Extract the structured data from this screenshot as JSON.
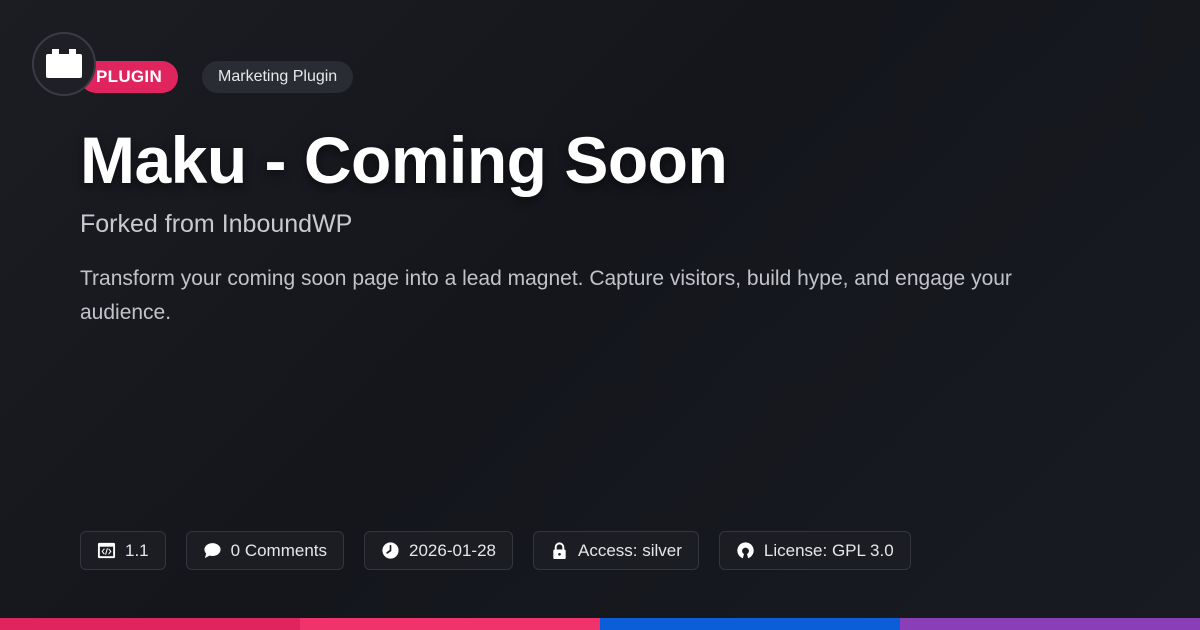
{
  "header": {
    "logo_icon": "plugin-block-icon",
    "type_tag": "PLUGIN",
    "category_tag": "Marketing Plugin"
  },
  "main": {
    "title": "Maku - Coming Soon",
    "subtitle": "Forked from InboundWP",
    "description": "Transform your coming soon page into a lead magnet. Capture visitors, build hype, and engage your audience."
  },
  "meta": {
    "version": "1.1",
    "comments": "0 Comments",
    "date": "2026-01-28",
    "access": "Access: silver",
    "license": "License: GPL 3.0"
  },
  "colors": {
    "accent": "#e0245e",
    "bar": [
      "#e0245e",
      "#f0336a",
      "#0b5ed7",
      "#8a3fb8"
    ]
  }
}
